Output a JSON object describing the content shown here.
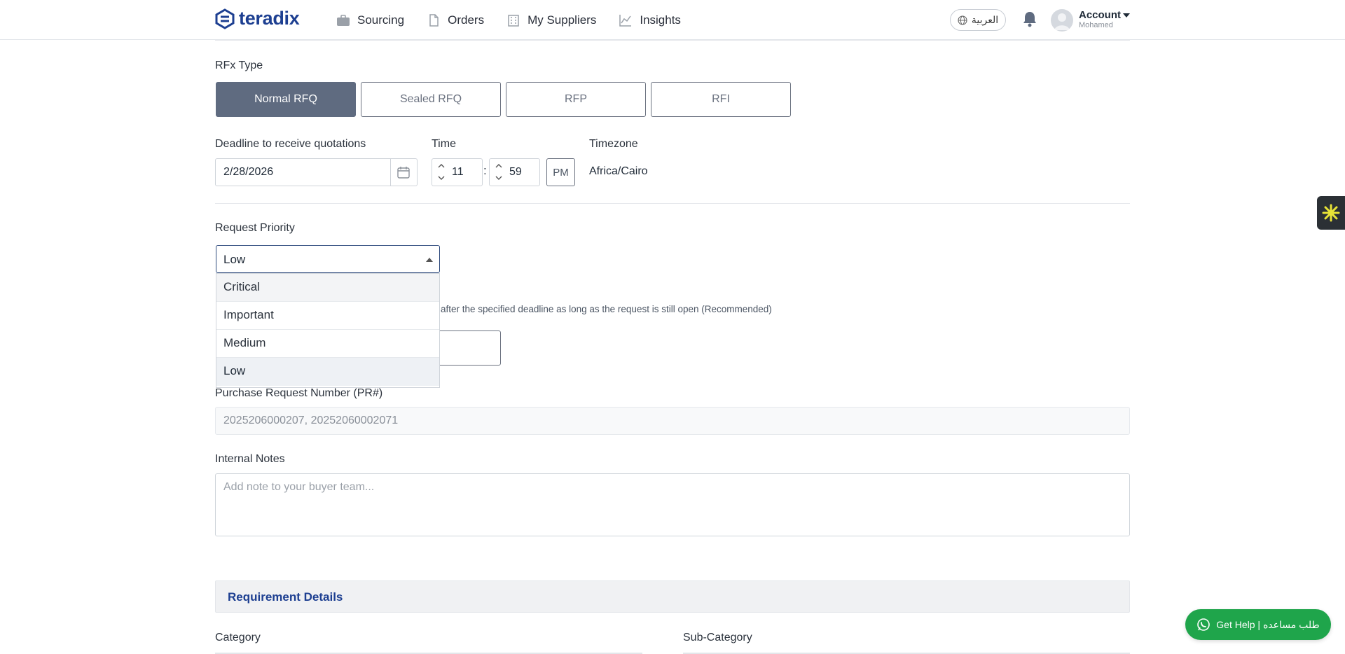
{
  "header": {
    "logo_text": "teradix",
    "nav": [
      {
        "label": "Sourcing",
        "icon": "briefcase-icon"
      },
      {
        "label": "Orders",
        "icon": "document-icon"
      },
      {
        "label": "My Suppliers",
        "icon": "building-icon"
      },
      {
        "label": "Insights",
        "icon": "chart-line-icon"
      }
    ],
    "language_label": "العربية",
    "account_label": "Account",
    "account_user": "Mohamed"
  },
  "rfx": {
    "label": "RFx Type",
    "options": [
      "Normal RFQ",
      "Sealed RFQ",
      "RFP",
      "RFI"
    ],
    "selected": "Normal RFQ"
  },
  "deadline": {
    "label": "Deadline to receive quotations",
    "date": "2/28/2026",
    "time_label": "Time",
    "hour": "11",
    "minute": "59",
    "ampm": "PM",
    "timezone_label": "Timezone",
    "timezone": "Africa/Cairo"
  },
  "priority": {
    "label": "Request Priority",
    "value": "Low",
    "options": [
      "Critical",
      "Important",
      "Medium",
      "Low"
    ]
  },
  "late_quotes_hint": "after the specified deadline as long as the request is still open (Recommended)",
  "pr": {
    "label": "Purchase Request Number (PR#)",
    "value": "2025206000207, 20252060002071"
  },
  "notes": {
    "label": "Internal Notes",
    "placeholder": "Add note to your buyer team..."
  },
  "requirements": {
    "title": "Requirement Details",
    "category_label": "Category",
    "subcategory_label": "Sub-Category"
  },
  "help": {
    "label": "Get Help | طلب مساعده"
  },
  "colors": {
    "brand": "#1d3f91",
    "active_button": "#5f6b80",
    "help_green": "#1fa54b"
  }
}
